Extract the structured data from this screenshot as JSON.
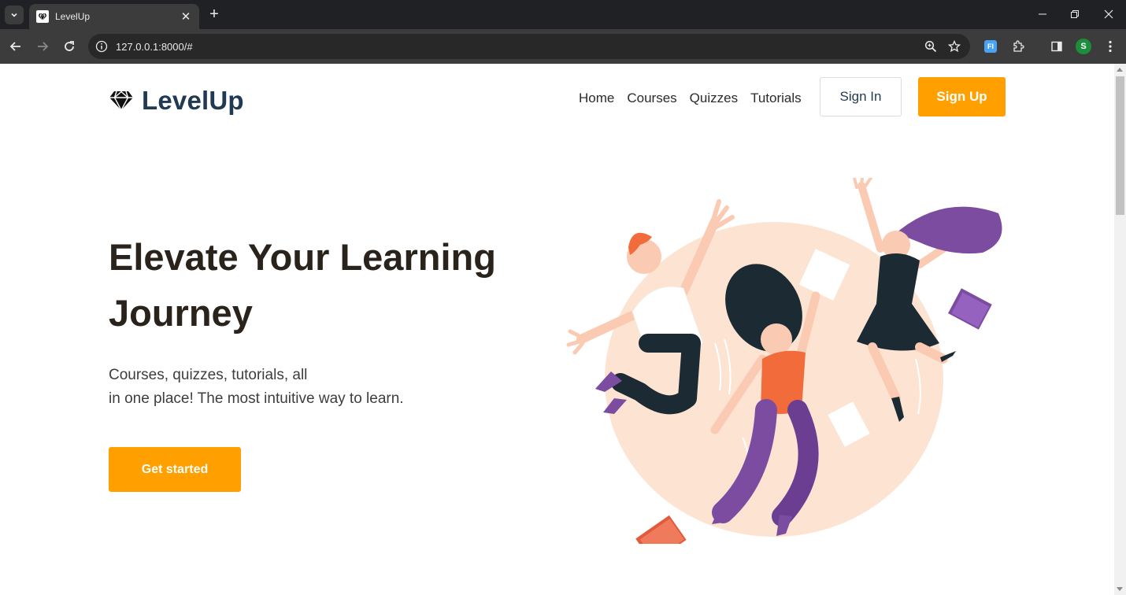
{
  "browser": {
    "tab_title": "LevelUp",
    "url": "127.0.0.1:8000/#",
    "new_tab_label": "+",
    "tab_close_label": "✕",
    "profile_initial": "S",
    "extension_label": "FI"
  },
  "site": {
    "brand": "LevelUp",
    "nav": [
      {
        "label": "Home"
      },
      {
        "label": "Courses"
      },
      {
        "label": "Quizzes"
      },
      {
        "label": "Tutorials"
      }
    ],
    "sign_in": "Sign In",
    "sign_up": "Sign Up"
  },
  "hero": {
    "title_line1": "Elevate Your Learning",
    "title_line2": "Journey",
    "subtitle_line1": "Courses, quizzes, tutorials, all",
    "subtitle_line2": "in one place! The most intuitive way to learn.",
    "cta": "Get started"
  },
  "colors": {
    "accent": "#ff9f00",
    "brand_text": "#1f3a52",
    "heading": "#2a231c",
    "illustration_circle": "#fde4d2"
  },
  "icons": {
    "logo": "diamond-icon",
    "illustration": "jumping-students-illustration"
  }
}
